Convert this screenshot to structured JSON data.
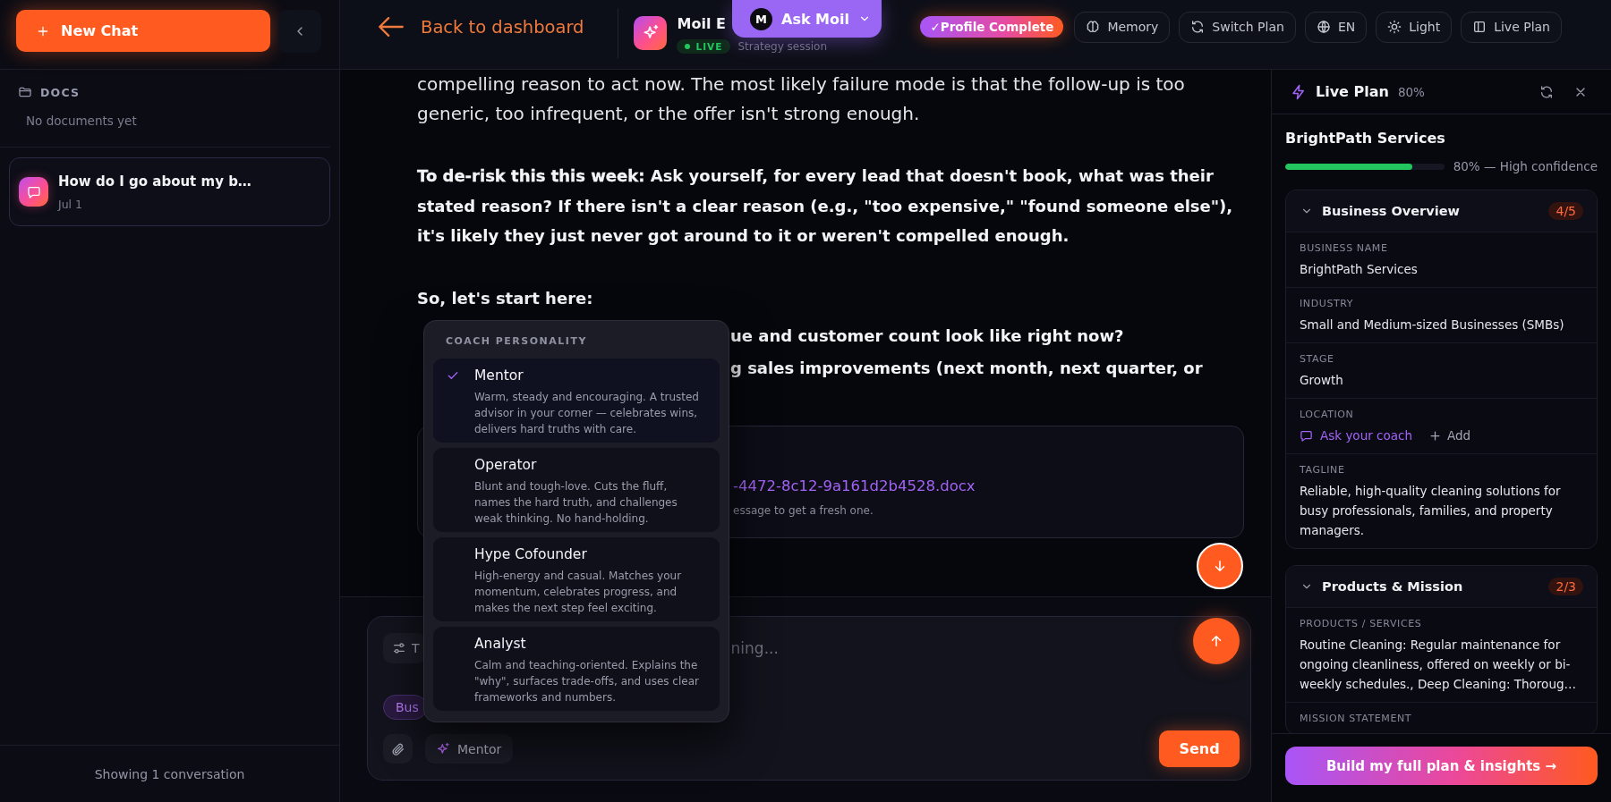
{
  "sidebar": {
    "new_chat_button": "New Chat",
    "docs": {
      "title": "DOCS",
      "empty_text": "No documents yet"
    },
    "conversations": [
      {
        "title": "How do I go about my b…",
        "date": "Jul 1",
        "selected": true
      }
    ],
    "footer": "Showing 1 conversation"
  },
  "header": {
    "back_link": "Back to dashboard",
    "chat": {
      "title": "Moil E",
      "status": "LIVE",
      "subtitle": "Strategy session"
    },
    "ask_button": {
      "avatar": "M",
      "label": "Ask Moil"
    },
    "profile_badge": "✓Profile Complete",
    "buttons": [
      {
        "kind": "memory",
        "label": "Memory"
      },
      {
        "kind": "switch",
        "label": "Switch Plan"
      },
      {
        "kind": "language",
        "label": "EN"
      },
      {
        "kind": "theme",
        "label": "Light"
      },
      {
        "kind": "panel",
        "label": "Live Plan"
      }
    ]
  },
  "messages": {
    "paragraphs": [
      {
        "kind": "text",
        "text": "compelling reason to act now. The most likely failure mode is that the follow-up is too generic, too infrequent, or the offer isn't strong enough."
      },
      {
        "kind": "emphasis",
        "text": "**To de-risk this this week:** Ask yourself, for every lead that doesn't book, what was their stated reason? If there isn't a clear reason (e.g., \"too expensive,\" \"found someone else\"), it's likely they just never got around to it or weren't compelled enough."
      },
      {
        "kind": "heading",
        "text": "So, let's start here:"
      }
    ],
    "list_lines": [
      "ue and customer count look like right now?",
      "g sales improvements (next month, next quarter, or"
    ],
    "attachment": {
      "file": "-4472-8c12-9a161d2b4528.docx",
      "note": "essage to get a fresh one."
    }
  },
  "composer": {
    "tools_button": "T",
    "placeholder": "ning...",
    "tag": "Bus",
    "personality_button": "Mentor",
    "send_button": "Send"
  },
  "personality_menu": {
    "title": "COACH PERSONALITY",
    "options": [
      {
        "name": "Mentor",
        "description": "Warm, steady and encouraging. A trusted advisor in your corner — celebrates wins, delivers hard truths with care.",
        "selected": true
      },
      {
        "name": "Operator",
        "description": "Blunt and tough-love. Cuts the fluff, names the hard truth, and challenges weak thinking. No hand-holding.",
        "selected": false
      },
      {
        "name": "Hype Cofounder",
        "description": "High-energy and casual. Matches your momentum, celebrates progress, and makes the next step feel exciting.",
        "selected": false
      },
      {
        "name": "Analyst",
        "description": "Calm and teaching-oriented. Explains the \"why\", surfaces trade-offs, and uses clear frameworks and numbers.",
        "selected": false
      }
    ]
  },
  "live_plan": {
    "title": "Live Plan",
    "percent": "80%",
    "business_name": "BrightPath Services",
    "confidence": {
      "level": 0.8,
      "label": "80% — High confidence"
    },
    "sections": [
      {
        "title": "Business Overview",
        "count": "4/5",
        "expanded": true,
        "fields": [
          {
            "kind": "value",
            "label": "BUSINESS NAME",
            "value": "BrightPath Services"
          },
          {
            "kind": "value",
            "label": "INDUSTRY",
            "value": "Small and Medium-sized Businesses (SMBs)"
          },
          {
            "kind": "value",
            "label": "STAGE",
            "value": "Growth"
          },
          {
            "kind": "missing",
            "label": "LOCATION",
            "ask_link": "Ask your coach",
            "add_button": "Add"
          },
          {
            "kind": "value",
            "label": "TAGLINE",
            "value": "Reliable, high-quality cleaning solutions for busy professionals, families, and property managers."
          }
        ]
      },
      {
        "title": "Products & Mission",
        "count": "2/3",
        "expanded": true,
        "fields": [
          {
            "kind": "value",
            "label": "PRODUCTS / SERVICES",
            "value": "Routine Cleaning: Regular maintenance for ongoing cleanliness, offered on weekly or bi-weekly schedules., Deep Cleaning: Thoroug…"
          },
          {
            "kind": "value",
            "label": "MISSION STATEMENT"
          }
        ]
      }
    ],
    "build_button": "Build my full plan & insights →"
  }
}
